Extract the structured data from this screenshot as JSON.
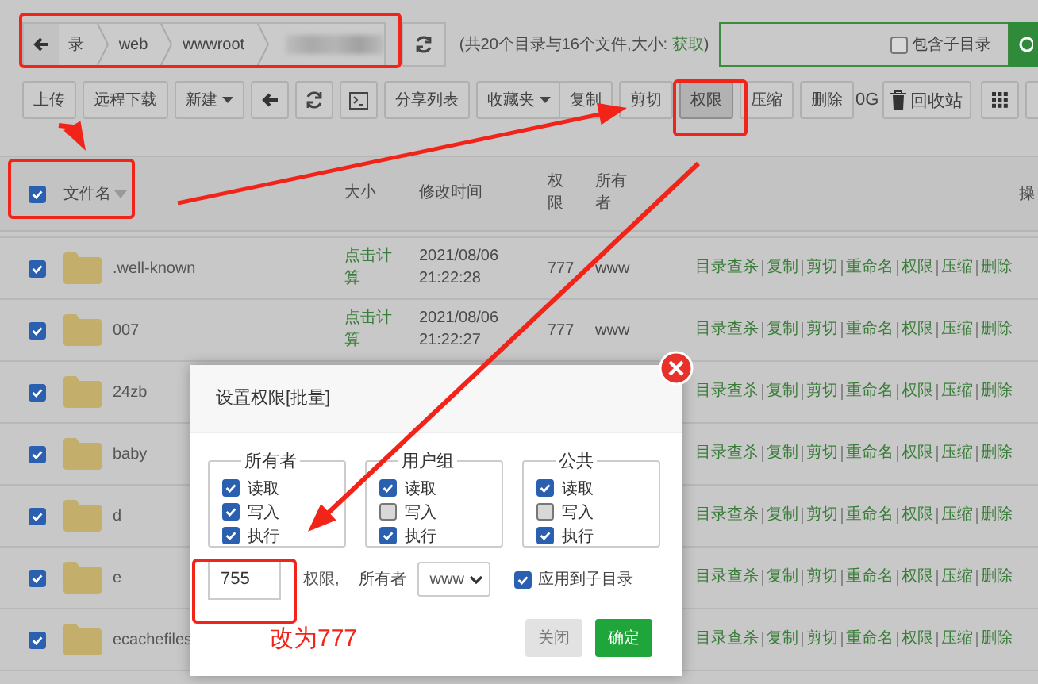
{
  "breadcrumb": {
    "segments": [
      "录",
      "web",
      "wwwroot"
    ]
  },
  "summary": {
    "prefix": "(共20个目录与16个文件,大小:",
    "link": "获取",
    "suffix": ")"
  },
  "search": {
    "subdir_label": "包含子目录",
    "subdir_checked": false
  },
  "toolbar": {
    "left_buttons": [
      {
        "label": "上传",
        "dropdown": false,
        "pressed": false
      },
      {
        "label": "远程下载",
        "dropdown": false,
        "pressed": false
      },
      {
        "label": "新建",
        "dropdown": true,
        "pressed": false
      }
    ],
    "right_buttons": [
      {
        "label": "分享列表",
        "dropdown": false,
        "pressed": false
      },
      {
        "label": "收藏夹",
        "dropdown": true,
        "pressed": false
      },
      {
        "label": "复制",
        "dropdown": false,
        "pressed": false
      },
      {
        "label": "剪切",
        "dropdown": false,
        "pressed": false
      },
      {
        "label": "权限",
        "dropdown": false,
        "pressed": true
      },
      {
        "label": "压缩",
        "dropdown": false,
        "pressed": false
      },
      {
        "label": "删除",
        "dropdown": false,
        "pressed": false
      }
    ],
    "disk_text": "0G",
    "recycle_label": "回收站"
  },
  "table": {
    "all_checked": true,
    "columns": [
      "文件名",
      "大小",
      "修改时间",
      "权限",
      "所有者",
      "操"
    ],
    "rows": [
      {
        "name": ".well-known",
        "selected": true,
        "size": "点击计算",
        "modified": "2021/08/06 21:22:28",
        "permission": "777",
        "owner": "www",
        "actions": [
          "目录查杀",
          "复制",
          "剪切",
          "重命名",
          "权限",
          "压缩",
          "删除"
        ]
      },
      {
        "name": "007",
        "selected": true,
        "size": "点击计算",
        "modified": "2021/08/06 21:22:27",
        "permission": "777",
        "owner": "www",
        "actions": [
          "目录查杀",
          "复制",
          "剪切",
          "重命名",
          "权限",
          "压缩",
          "删除"
        ]
      },
      {
        "name": "24zb",
        "selected": true,
        "actions": [
          "目录查杀",
          "复制",
          "剪切",
          "重命名",
          "权限",
          "压缩",
          "删除"
        ]
      },
      {
        "name": "baby",
        "selected": true,
        "actions": [
          "目录查杀",
          "复制",
          "剪切",
          "重命名",
          "权限",
          "压缩",
          "删除"
        ]
      },
      {
        "name": "d",
        "selected": true,
        "actions": [
          "目录查杀",
          "复制",
          "剪切",
          "重命名",
          "权限",
          "压缩",
          "删除"
        ]
      },
      {
        "name": "e",
        "selected": true,
        "actions": [
          "目录查杀",
          "复制",
          "剪切",
          "重命名",
          "权限",
          "压缩",
          "删除"
        ]
      },
      {
        "name": "ecachefiles",
        "selected": true,
        "actions": [
          "目录查杀",
          "复制",
          "剪切",
          "重命名",
          "权限",
          "压缩",
          "删除"
        ]
      }
    ]
  },
  "dialog": {
    "title": "设置权限[批量]",
    "groups": [
      {
        "title": "所有者",
        "options": [
          {
            "label": "读取",
            "checked": true
          },
          {
            "label": "写入",
            "checked": true
          },
          {
            "label": "执行",
            "checked": true
          }
        ]
      },
      {
        "title": "用户组",
        "options": [
          {
            "label": "读取",
            "checked": true
          },
          {
            "label": "写入",
            "checked": false
          },
          {
            "label": "执行",
            "checked": true
          }
        ]
      },
      {
        "title": "公共",
        "options": [
          {
            "label": "读取",
            "checked": true
          },
          {
            "label": "写入",
            "checked": false
          },
          {
            "label": "执行",
            "checked": true
          }
        ]
      }
    ],
    "permission_value": "755",
    "permission_label": "权限,",
    "owner_label": "所有者",
    "owner_value": "www",
    "apply_sub_label": "应用到子目录",
    "apply_sub_checked": true,
    "note": "改为777",
    "cancel": "关闭",
    "cancel_disabled": true,
    "confirm": "确定"
  }
}
